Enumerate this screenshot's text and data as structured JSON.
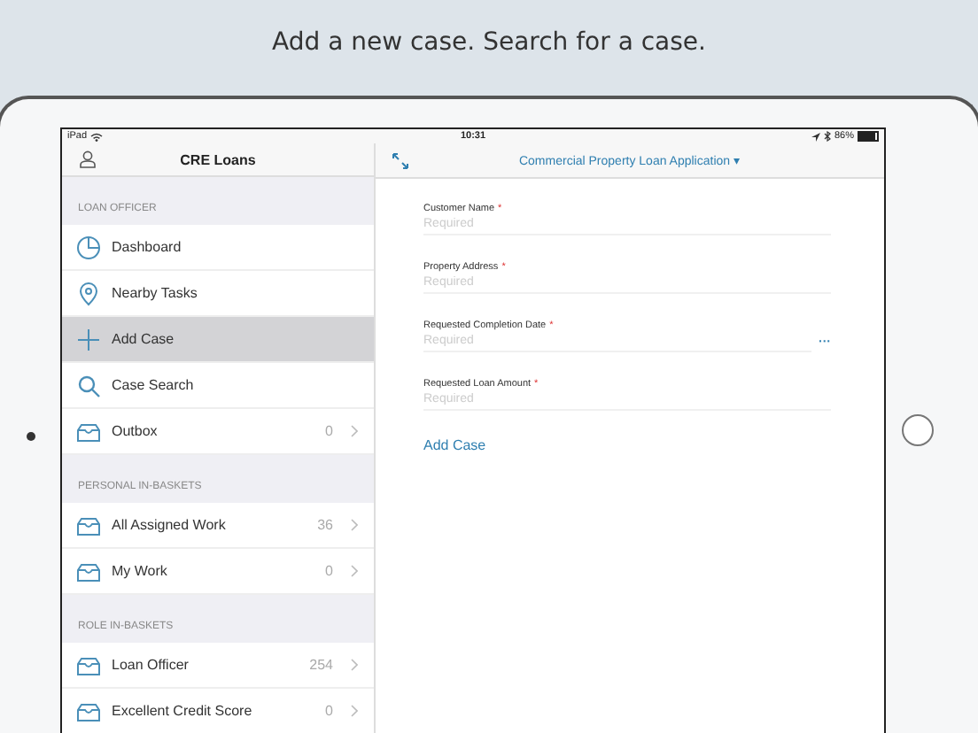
{
  "headline": "Add a new case. Search for a case.",
  "status_bar": {
    "device": "iPad",
    "time": "10:31",
    "battery": "86%"
  },
  "sidebar": {
    "title": "CRE Loans",
    "sections": [
      {
        "header": "LOAN OFFICER",
        "items": [
          {
            "label": "Dashboard",
            "kind": "dashboard",
            "selected": false
          },
          {
            "label": "Nearby Tasks",
            "kind": "location",
            "selected": false
          },
          {
            "label": "Add Case",
            "kind": "add",
            "selected": true
          },
          {
            "label": "Case Search",
            "kind": "search",
            "selected": false
          },
          {
            "label": "Outbox",
            "kind": "inbox",
            "count": "0",
            "selected": false
          }
        ]
      },
      {
        "header": "PERSONAL IN-BASKETS",
        "items": [
          {
            "label": "All Assigned Work",
            "kind": "inbox",
            "count": "36",
            "selected": false
          },
          {
            "label": "My Work",
            "kind": "inbox",
            "count": "0",
            "selected": false
          }
        ]
      },
      {
        "header": "ROLE IN-BASKETS",
        "items": [
          {
            "label": "Loan Officer",
            "kind": "inbox",
            "count": "254",
            "selected": false
          },
          {
            "label": "Excellent Credit Score",
            "kind": "inbox",
            "count": "0",
            "selected": false
          }
        ]
      }
    ]
  },
  "main": {
    "title": "Commercial Property Loan Application ▾",
    "fields": [
      {
        "label": "Customer Name",
        "required_mark": "*",
        "placeholder": "Required"
      },
      {
        "label": "Property Address",
        "required_mark": "*",
        "placeholder": "Required"
      },
      {
        "label": "Requested Completion Date",
        "required_mark": "*",
        "placeholder": "Required",
        "button": "···"
      },
      {
        "label": "Requested Loan Amount",
        "required_mark": "*",
        "placeholder": "Required"
      }
    ],
    "action": "Add Case"
  }
}
